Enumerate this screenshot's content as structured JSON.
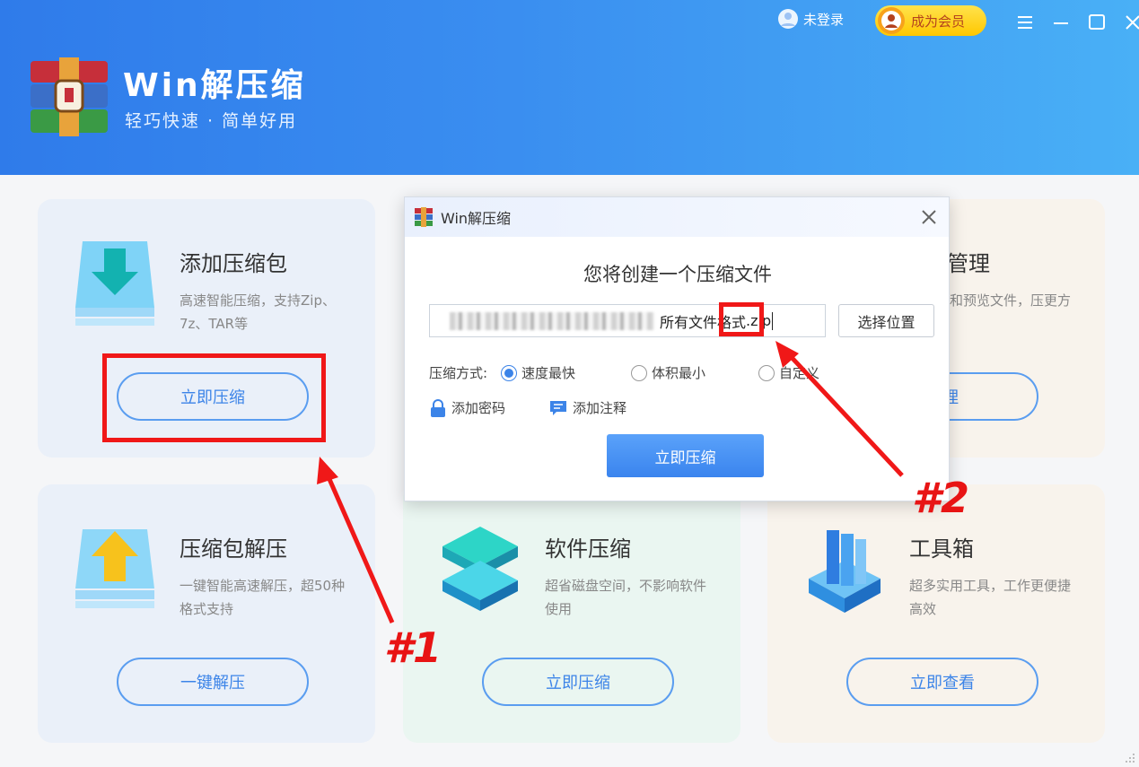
{
  "app": {
    "title": "Win解压缩",
    "slogan": "轻巧快速 · 简单好用"
  },
  "topbar": {
    "login_label": "未登录",
    "vip_label": "成为会员"
  },
  "cards": [
    {
      "title": "添加压缩包",
      "desc": "高速智能压缩，支持Zip、7z、TAR等",
      "button": "立即压缩"
    },
    {
      "title": "管理",
      "desc": "理和预览文件，压更方便",
      "button": "管理"
    },
    {
      "title": "压缩包解压",
      "desc": "一键智能高速解压，超50种格式支持",
      "button": "一键解压"
    },
    {
      "title": "软件压缩",
      "desc": "超省磁盘空间，不影响软件使用",
      "button": "立即压缩"
    },
    {
      "title": "工具箱",
      "desc": "超多实用工具，工作更便捷高效",
      "button": "立即查看"
    }
  ],
  "dialog": {
    "title": "Win解压缩",
    "heading": "您将创建一个压缩文件",
    "path_text": "所有文件格式",
    "path_ext": ".zip",
    "choose_label": "选择位置",
    "mode_label": "压缩方式:",
    "modes": [
      {
        "label": "速度最快",
        "checked": true
      },
      {
        "label": "体积最小",
        "checked": false
      },
      {
        "label": "自定义",
        "checked": false
      }
    ],
    "add_password": "添加密码",
    "add_comment": "添加注释",
    "submit_label": "立即压缩"
  },
  "annotations": {
    "mark1": "#1",
    "mark2": "#2",
    "color": "#e81414"
  },
  "colors": {
    "header_start": "#2f7bea",
    "header_end": "#49b0f6",
    "accent": "#3c84e8"
  }
}
